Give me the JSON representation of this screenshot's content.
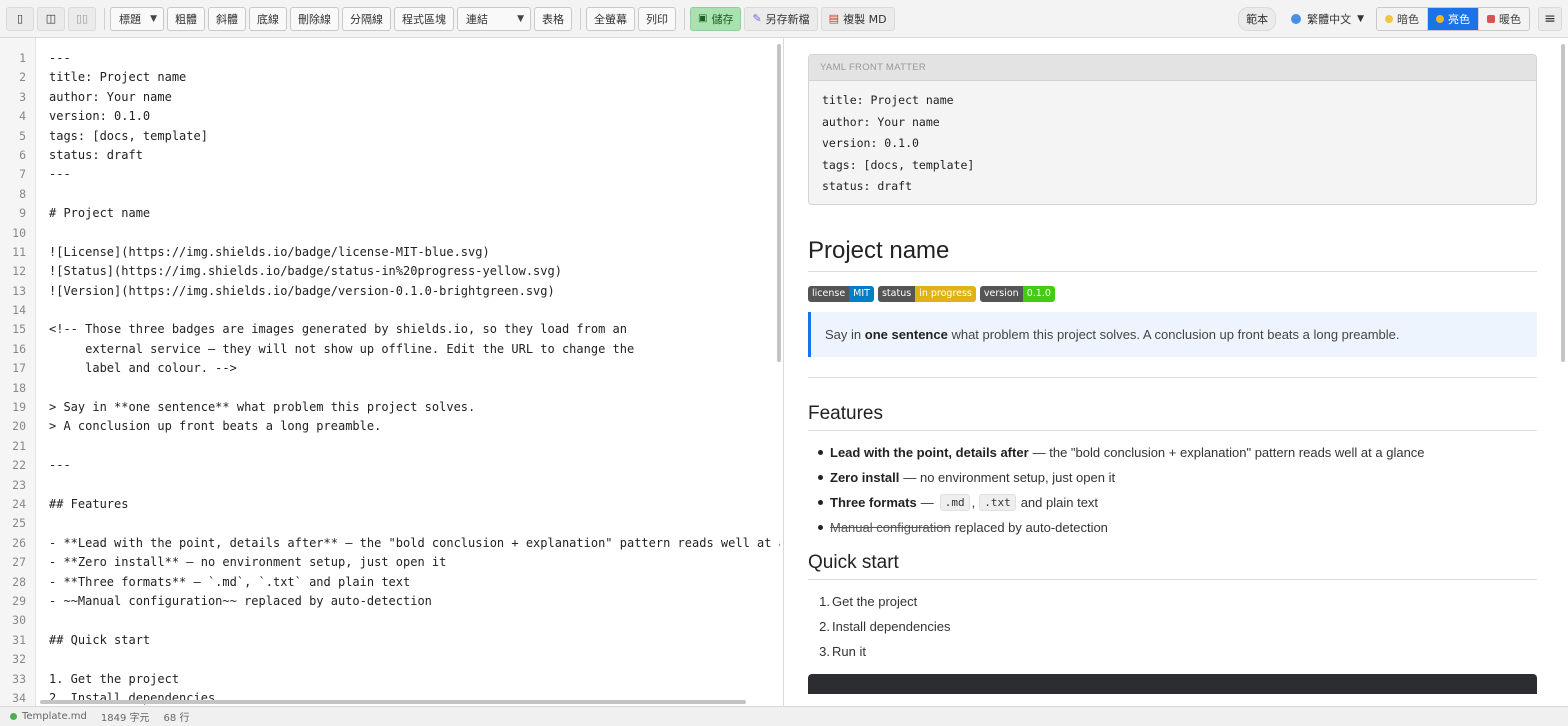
{
  "toolbar": {
    "view_buttons": [
      "▯",
      "◫",
      "▯▯"
    ],
    "heading_select": "標題",
    "format_buttons": [
      "粗體",
      "斜體",
      "底線",
      "刪除線",
      "分隔線",
      "程式區塊"
    ],
    "link_select": "連結",
    "table_button": "表格",
    "fullscreen_button": "全螢幕",
    "print_button": "列印",
    "save_button": "儲存",
    "save_as_button": "另存新檔",
    "copy_md_button": "複製 MD",
    "sample_button": "範本",
    "language": "繁體中文",
    "themes": [
      "暗色",
      "亮色",
      "暖色"
    ],
    "active_theme": "亮色",
    "menu_icon": "≡"
  },
  "editor": {
    "lines": [
      {
        "n": "1",
        "t": "---"
      },
      {
        "n": "2",
        "t": "title: Project name"
      },
      {
        "n": "3",
        "t": "author: Your name"
      },
      {
        "n": "4",
        "t": "version: 0.1.0"
      },
      {
        "n": "5",
        "t": "tags: [docs, template]"
      },
      {
        "n": "6",
        "t": "status: draft"
      },
      {
        "n": "7",
        "t": "---"
      },
      {
        "n": "8",
        "t": ""
      },
      {
        "n": "9",
        "t": "# Project name"
      },
      {
        "n": "10",
        "t": ""
      },
      {
        "n": "11",
        "t": "![License](https://img.shields.io/badge/license-MIT-blue.svg)"
      },
      {
        "n": "12",
        "t": "![Status](https://img.shields.io/badge/status-in%20progress-yellow.svg)"
      },
      {
        "n": "13",
        "t": "![Version](https://img.shields.io/badge/version-0.1.0-brightgreen.svg)"
      },
      {
        "n": "14",
        "t": ""
      },
      {
        "n": "15",
        "t": "<!-- Those three badges are images generated by shields.io, so they load from an"
      },
      {
        "n": "16",
        "t": "     external service — they will not show up offline. Edit the URL to change the"
      },
      {
        "n": "17",
        "t": "     label and colour. -->"
      },
      {
        "n": "18",
        "t": ""
      },
      {
        "n": "19",
        "t": "> Say in **one sentence** what problem this project solves."
      },
      {
        "n": "20",
        "t": "> A conclusion up front beats a long preamble."
      },
      {
        "n": "21",
        "t": ""
      },
      {
        "n": "22",
        "t": "---"
      },
      {
        "n": "23",
        "t": ""
      },
      {
        "n": "24",
        "t": "## Features"
      },
      {
        "n": "25",
        "t": ""
      },
      {
        "n": "26",
        "t": "- **Lead with the point, details after** — the \"bold conclusion + explanation\" pattern reads well at a gla"
      },
      {
        "n": "27",
        "t": "- **Zero install** — no environment setup, just open it"
      },
      {
        "n": "28",
        "t": "- **Three formats** — `.md`, `.txt` and plain text"
      },
      {
        "n": "29",
        "t": "- ~~Manual configuration~~ replaced by auto-detection"
      },
      {
        "n": "30",
        "t": ""
      },
      {
        "n": "31",
        "t": "## Quick start"
      },
      {
        "n": "32",
        "t": ""
      },
      {
        "n": "33",
        "t": "1. Get the project"
      },
      {
        "n": "34",
        "t": "2. Install dependencies"
      }
    ]
  },
  "preview": {
    "yaml_header": "YAML FRONT MATTER",
    "yaml_lines": [
      "title: Project name",
      "author: Your name",
      "version: 0.1.0",
      "tags: [docs, template]",
      "status: draft"
    ],
    "h1": "Project name",
    "badges": [
      {
        "label": "license",
        "value": "MIT",
        "color": "#007ec6"
      },
      {
        "label": "status",
        "value": "in progress",
        "color": "#dfb317"
      },
      {
        "label": "version",
        "value": "0.1.0",
        "color": "#4c1"
      }
    ],
    "quote": {
      "pre": "Say in ",
      "bold": "one sentence",
      "post": " what problem this project solves. A conclusion up front beats a long preamble."
    },
    "features_heading": "Features",
    "features": [
      {
        "bold": "Lead with the point, details after",
        "rest": "— the \"bold conclusion + explanation\" pattern reads well at a glance"
      },
      {
        "bold": "Zero install",
        "rest": "— no environment setup, just open it"
      },
      {
        "bold": "Three formats",
        "dash": "—",
        "code1": ".md",
        "comma": ",",
        "code2": ".txt",
        "rest": "and plain text"
      },
      {
        "strike": "Manual configuration",
        "rest": "replaced by auto-detection"
      }
    ],
    "quickstart_heading": "Quick start",
    "steps": [
      {
        "num": "1.",
        "text": "Get the project"
      },
      {
        "num": "2.",
        "text": "Install dependencies"
      },
      {
        "num": "3.",
        "text": "Run it"
      }
    ]
  },
  "status": {
    "file": "Template.md",
    "chars": "1849 字元",
    "lines": "68 行"
  }
}
